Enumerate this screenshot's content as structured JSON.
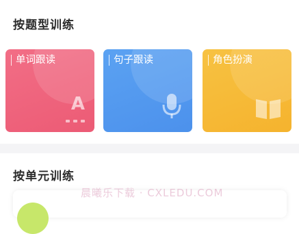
{
  "sections": {
    "by_type_title": "按题型训练",
    "by_unit_title": "按单元训练"
  },
  "cards": {
    "word": {
      "label": "单词跟读",
      "icon": "letter-a-icon",
      "color": "#ef6580"
    },
    "sentence": {
      "label": "句子跟读",
      "icon": "microphone-icon",
      "color": "#529af0"
    },
    "role": {
      "label": "角色扮演",
      "icon": "book-icon",
      "color": "#f6bb38"
    }
  },
  "icon_glyphs": {
    "letter_a": "A"
  },
  "watermark": "晨曦乐下载 · CXLEDU.COM"
}
